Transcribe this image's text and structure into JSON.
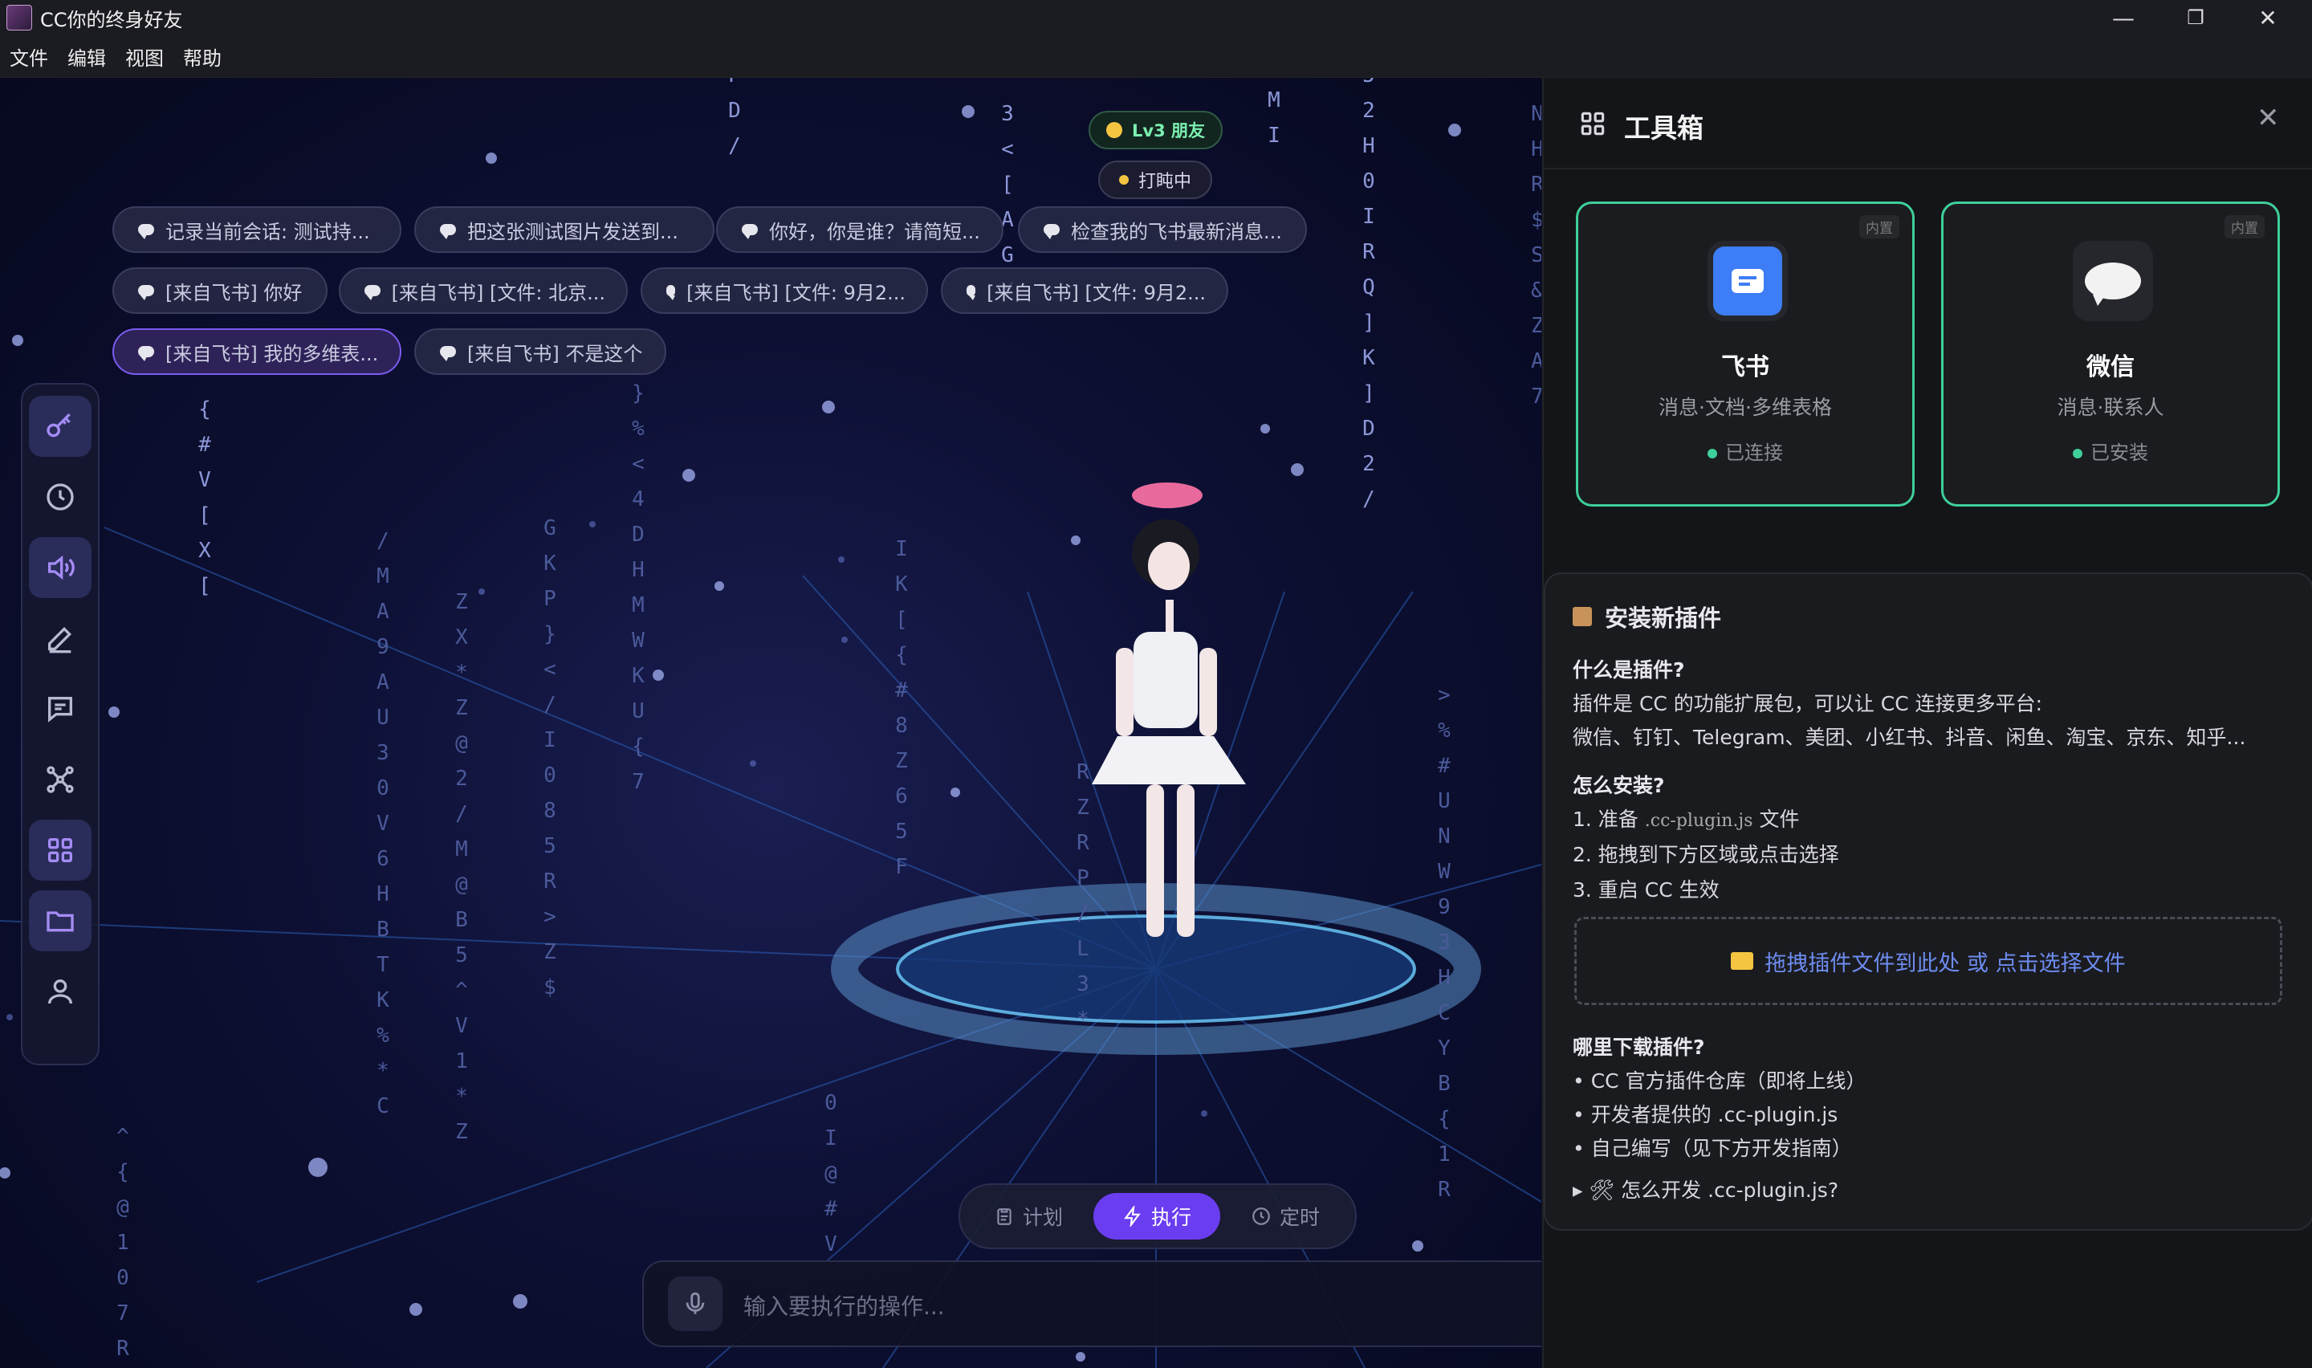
{
  "window": {
    "title": "CC你的终身好友",
    "min": "—",
    "max": "❐",
    "close": "✕"
  },
  "menu": [
    "文件",
    "编辑",
    "视图",
    "帮助"
  ],
  "badges": {
    "level": "Lv3 朋友",
    "status": "打盹中"
  },
  "chips": [
    "记录当前会话: 测试持...",
    "把这张测试图片发送到...",
    "你好，你是谁？请简短...",
    "检查我的飞书最新消息...",
    "[来自飞书] 你好",
    "[来自飞书] [文件: 北京...",
    "[来自飞书] [文件: 9月2...",
    "[来自飞书] [文件: 9月2...",
    "[来自飞书] 我的多维表...",
    "[来自飞书] 不是这个"
  ],
  "modes": {
    "plan": "计划",
    "execute": "执行",
    "schedule": "定时"
  },
  "input": {
    "placeholder": "输入要执行的操作..."
  },
  "panel": {
    "title": "工具箱",
    "cards": [
      {
        "tag": "内置",
        "name": "飞书",
        "desc": "消息·文档·多维表格",
        "status": "已连接"
      },
      {
        "tag": "内置",
        "name": "微信",
        "desc": "消息·联系人",
        "status": "已安装"
      }
    ],
    "install": {
      "title": "安装新插件",
      "what_q": "什么是插件?",
      "what_a1": "插件是 CC 的功能扩展包，可以让 CC 连接更多平台:",
      "what_a2": "微信、钉钉、Telegram、美团、小红书、抖音、闲鱼、淘宝、京东、知乎...",
      "how_q": "怎么安装?",
      "step1_pre": "1. 准备",
      "step1_code": ".cc-plugin.js",
      "step1_post": "文件",
      "step2": "2. 拖拽到下方区域或点击选择",
      "step3": "3. 重启 CC 生效",
      "dropzone": "拖拽插件文件到此处 或 点击选择文件",
      "where_q": "哪里下载插件?",
      "where1": "• CC 官方插件仓库（即将上线）",
      "where2": "• 开发者提供的 .cc-plugin.js",
      "where3": "• 自己编写（见下方开发指南）",
      "dev": "▸ 🛠 怎么开发 .cc-plugin.js?"
    }
  },
  "matrix_columns": [
    {
      "chars": "P D /"
    },
    {
      "chars": "3 < [ A G Y"
    },
    {
      "chars": "M I"
    },
    {
      "chars": "5 2 H 0 I R Q ] K ] D 2 /"
    },
    {
      "chars": "N H R $ S & Z A 7"
    },
    {
      "chars": "{ # V [ X ["
    },
    {
      "chars": "/ M A 9 A U 3 0 V 6 H B T K % * C"
    },
    {
      "chars": "Z X * Z @ 2 / M @ B 5 ^ V 1 * Z"
    },
    {
      "chars": "G K P } < / I 0 8 5 R > Z $"
    },
    {
      "chars": "} % < 4 D H M W K U { 7"
    },
    {
      "chars": "I K [ { # 8 Z 6 5 F"
    },
    {
      "chars": "R Z R P / L 3 *"
    },
    {
      "chars": "> % # U N W 9 3 H C Y B { 1 R"
    },
    {
      "chars": "^ { @ 1 0 7 R"
    },
    {
      "chars": "0 I @ # V"
    }
  ]
}
